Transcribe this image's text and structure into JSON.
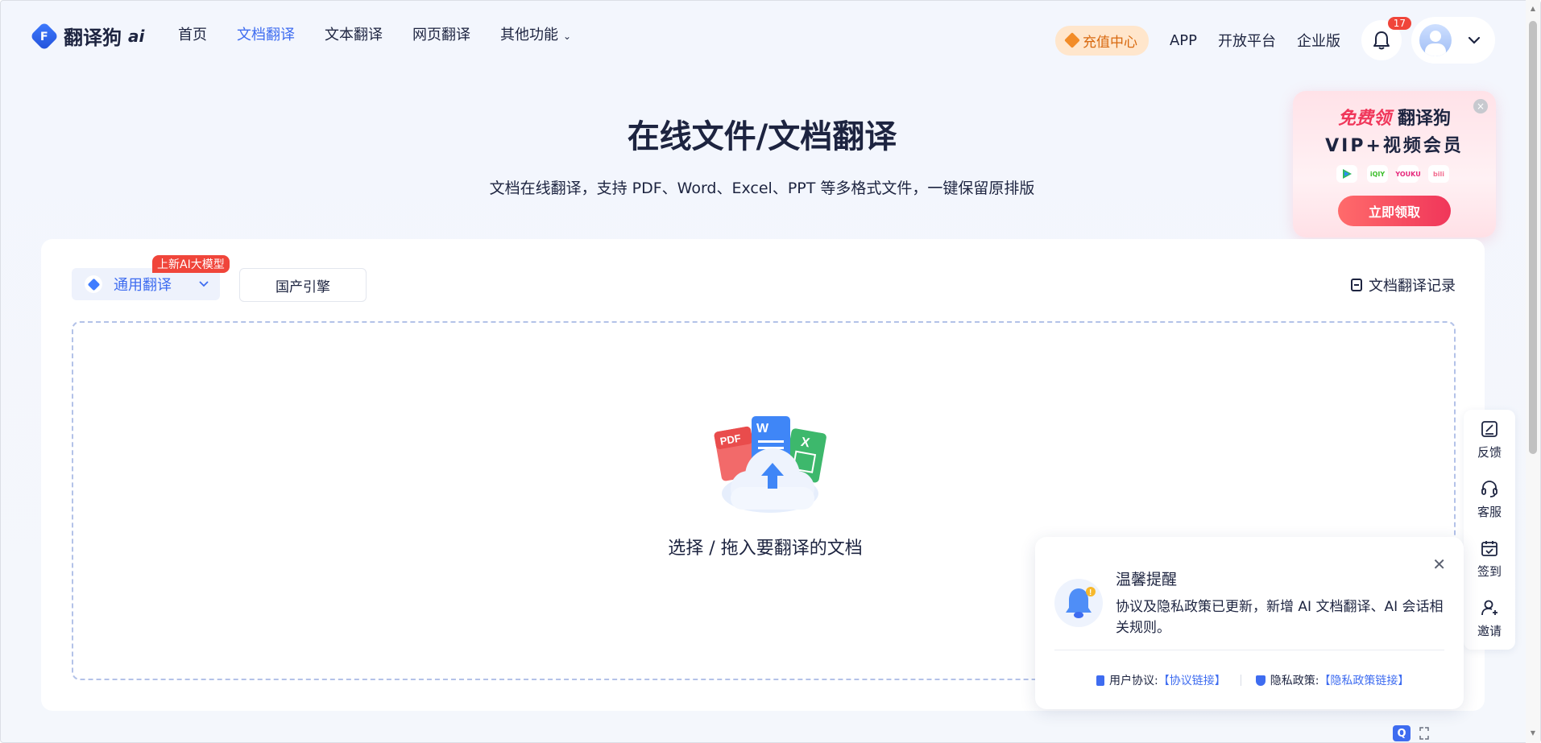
{
  "header": {
    "logo_text": "翻译狗",
    "logo_ai": "ai",
    "nav": [
      {
        "label": "首页",
        "active": false
      },
      {
        "label": "文档翻译",
        "active": true
      },
      {
        "label": "文本翻译",
        "active": false
      },
      {
        "label": "网页翻译",
        "active": false
      },
      {
        "label": "其他功能",
        "active": false
      }
    ],
    "recharge_label": "充值中心",
    "app_label": "APP",
    "open_platform_label": "开放平台",
    "enterprise_label": "企业版",
    "notification_count": "17"
  },
  "hero": {
    "title": "在线文件/文档翻译",
    "subtitle": "文档在线翻译，支持 PDF、Word、Excel、PPT 等多格式文件，一键保留原排版"
  },
  "promo": {
    "highlight": "免费领",
    "line1_rest": "翻译狗",
    "line2": "VIP+视频会员",
    "icons": [
      "tencent-video",
      "iqiyi",
      "youku",
      "bilibili"
    ],
    "button_label": "立即领取",
    "close_label": "×"
  },
  "card": {
    "engine_selected": "通用翻译",
    "new_badge": "上新AI大模型",
    "engine_alt": "国产引擎",
    "records_label": "文档翻译记录",
    "drop_text": "选择 / 拖入要翻译的文档",
    "file_types": [
      "PDF",
      "W",
      "X"
    ]
  },
  "toolbar": [
    {
      "label": "反馈",
      "icon": "feedback-icon"
    },
    {
      "label": "客服",
      "icon": "headset-icon"
    },
    {
      "label": "签到",
      "icon": "calendar-check-icon"
    },
    {
      "label": "邀请",
      "icon": "invite-user-icon"
    }
  ],
  "notice": {
    "title": "温馨提醒",
    "body": "协议及隐私政策已更新，新增 AI 文档翻译、AI 会话相关规则。",
    "user_agreement_label": "用户协议:",
    "user_agreement_link": "【协议链接】",
    "privacy_label": "隐私政策:",
    "privacy_link": "【隐私政策链接】",
    "close_label": "✕"
  },
  "colors": {
    "accent": "#3e6cf0",
    "badge_red": "#f0453a",
    "recharge_bg": "#ffe6cc",
    "recharge_text": "#d8690f"
  }
}
